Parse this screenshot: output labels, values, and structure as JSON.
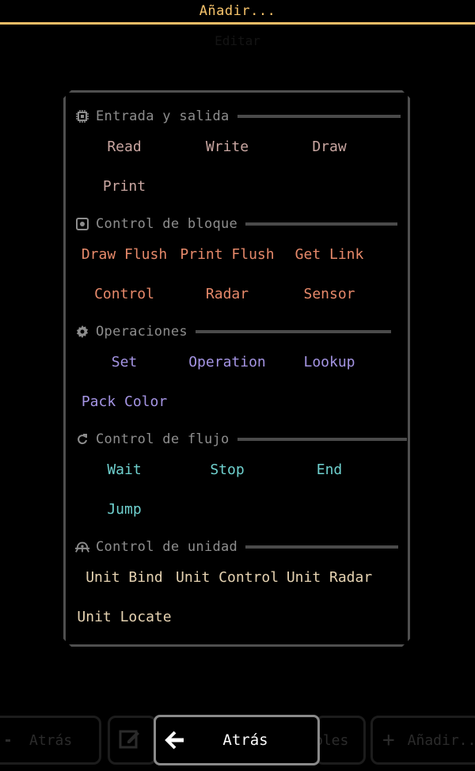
{
  "header": {
    "title": "Añadir..."
  },
  "background": {
    "hint": "Editar"
  },
  "sections": {
    "io": {
      "title": "Entrada y salida",
      "icon": "chip-icon",
      "items": [
        "Read",
        "Write",
        "Draw",
        "Print"
      ]
    },
    "block": {
      "title": "Control de bloque",
      "icon": "block-icon",
      "items": [
        "Draw Flush",
        "Print Flush",
        "Get Link",
        "Control",
        "Radar",
        "Sensor"
      ]
    },
    "ops": {
      "title": "Operaciones",
      "icon": "gear-icon",
      "items": [
        "Set",
        "Operation",
        "Lookup",
        "Pack Color"
      ]
    },
    "flow": {
      "title": "Control de flujo",
      "icon": "refresh-icon",
      "items": [
        "Wait",
        "Stop",
        "End",
        "Jump"
      ]
    },
    "unit": {
      "title": "Control de unidad",
      "icon": "unit-icon",
      "items": [
        "Unit Bind",
        "Unit Control",
        "Unit Radar",
        "Unit Locate"
      ]
    }
  },
  "bottom_bar": {
    "back_label": "Atrás",
    "bg_back_label": "Atrás",
    "bg_variables_label": "bles",
    "bg_add_label": "Añadir..."
  },
  "colors": {
    "accent": "#f3be67",
    "io": "#c9a6a1",
    "block": "#e6896a",
    "ops": "#a494e3",
    "flow": "#6fd1cf",
    "unit": "#e6d3b2"
  }
}
